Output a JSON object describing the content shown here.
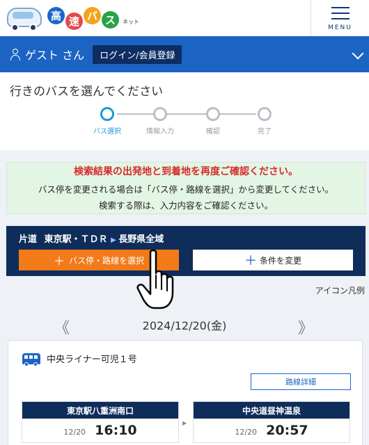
{
  "header": {
    "logo_chars": [
      "高",
      "速",
      "バ",
      "ス"
    ],
    "logo_suffix": "ネット",
    "menu_label": "MENU"
  },
  "userbar": {
    "guest": "ゲスト さん",
    "login": "ログイン/会員登録"
  },
  "page": {
    "title": "行きのバスを選んでください"
  },
  "steps": [
    {
      "label": "バス選択",
      "active": true
    },
    {
      "label": "情報入力",
      "active": false
    },
    {
      "label": "確認",
      "active": false
    },
    {
      "label": "完了",
      "active": false
    }
  ],
  "notice": {
    "headline": "検索結果の出発地と到着地を再度ご確認ください。",
    "line1": "バス停を変更される場合は「バス停・路線を選択」から変更してください。",
    "line2": "検索する際は、入力内容をご確認ください。"
  },
  "route": {
    "trip_type": "片道",
    "from": "東京駅・ＴＤＲ",
    "to": "長野県全域",
    "select_button": "バス停・路線を選択",
    "condition_button": "条件を変更"
  },
  "icon_legend": "アイコン凡例",
  "date": {
    "current": "2024/12/20(金)",
    "prev": "《",
    "next": "》"
  },
  "bus": {
    "name": "中央ライナー可児１号",
    "detail_button": "路線詳細",
    "departure": {
      "stop": "東京駅八重洲南口",
      "date": "12/20",
      "time": "16:10"
    },
    "arrival": {
      "stop": "中央道昼神温泉",
      "date": "12/20",
      "time": "20:57"
    }
  },
  "colors": {
    "primary_blue": "#1c64c4",
    "navy": "#0e2d5a",
    "orange": "#f27a19",
    "alert_red": "#d62c2c",
    "notice_bg": "#e3f5e5",
    "step_active": "#1c9bd8"
  }
}
